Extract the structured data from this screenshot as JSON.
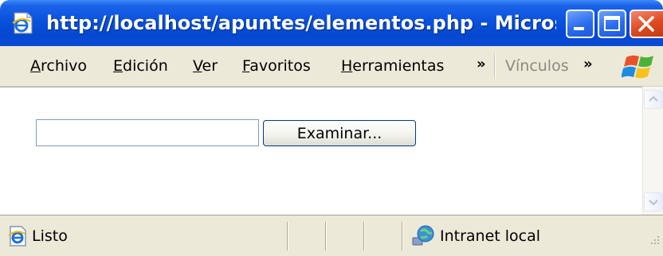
{
  "window": {
    "title": "http://localhost/apuntes/elementos.php - Micros...",
    "accent_color": "#0a51dc",
    "close_color": "#df4a21"
  },
  "menu": {
    "items": [
      {
        "label": "Archivo",
        "underline": "A",
        "rest": "rchivo"
      },
      {
        "label": "Edición",
        "underline": "E",
        "rest": "dición"
      },
      {
        "label": "Ver",
        "underline": "V",
        "rest": "er"
      },
      {
        "label": "Favoritos",
        "underline": "F",
        "rest": "avoritos"
      },
      {
        "label": "Herramientas",
        "underline": "H",
        "rest": "erramientas"
      }
    ],
    "overflow_glyph": "»",
    "links_label": "Vínculos"
  },
  "form": {
    "file_input_value": "",
    "browse_label": "Examinar..."
  },
  "status": {
    "text": "Listo",
    "zone": "Intranet local"
  },
  "icons": {
    "app": "ie-page-icon",
    "logo": "windows-flag-icon",
    "status": "ie-page-icon",
    "zone": "intranet-globe-icon"
  }
}
